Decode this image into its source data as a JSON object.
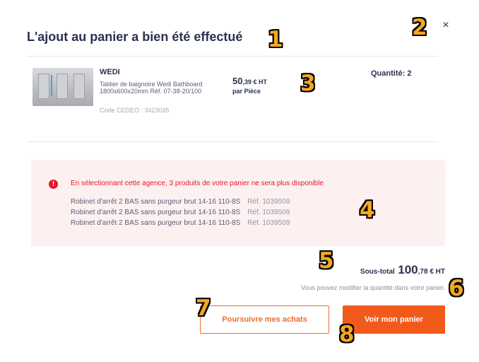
{
  "modal": {
    "title": "L'ajout au panier a bien été effectué",
    "close_icon": "close-icon",
    "close_glyph": "×"
  },
  "product": {
    "brand": "WEDI",
    "description": "Tablier de baignoire Wedi Bathboard 1800x600x20mm Réf. 07-38-20/100",
    "code": "Code CEDEO : 3423035",
    "price_integer": "50",
    "price_decimal": ",39 € HT",
    "price_unit": "par Pièce",
    "quantity": "Quantité: 2"
  },
  "alert": {
    "icon": "alert-icon",
    "icon_glyph": "!",
    "message": "En sélectionnant cette agence, 3 produits de votre panier ne sera plus disponible",
    "items": [
      {
        "name": "Robinet d'arrêt 2 BAS sans purgeur brut 14-16 110-8S",
        "ref": "Réf. 1039509"
      },
      {
        "name": "Robinet d'arrêt 2 BAS sans purgeur brut 14-16 110-8S",
        "ref": "Réf. 1039509"
      },
      {
        "name": "Robinet d'arrêt 2 BAS sans purgeur brut 14-16 110-8S",
        "ref": "Réf. 1039509"
      }
    ]
  },
  "summary": {
    "subtotal_label": "Sous-total",
    "subtotal_integer": "100",
    "subtotal_rest": ",78 € HT",
    "hint": "Vous pouvez modifier la quantité dans votre panier."
  },
  "buttons": {
    "continue_label": "Poursuivre mes achats",
    "view_cart_label": "Voir mon panier"
  },
  "markers": [
    "1",
    "2",
    "3",
    "4",
    "5",
    "6",
    "7",
    "8"
  ],
  "colors": {
    "accent": "#f25a1c",
    "alert_red": "#e4172b",
    "alert_bg": "#fdf0f1",
    "marker": "#f5a623"
  }
}
